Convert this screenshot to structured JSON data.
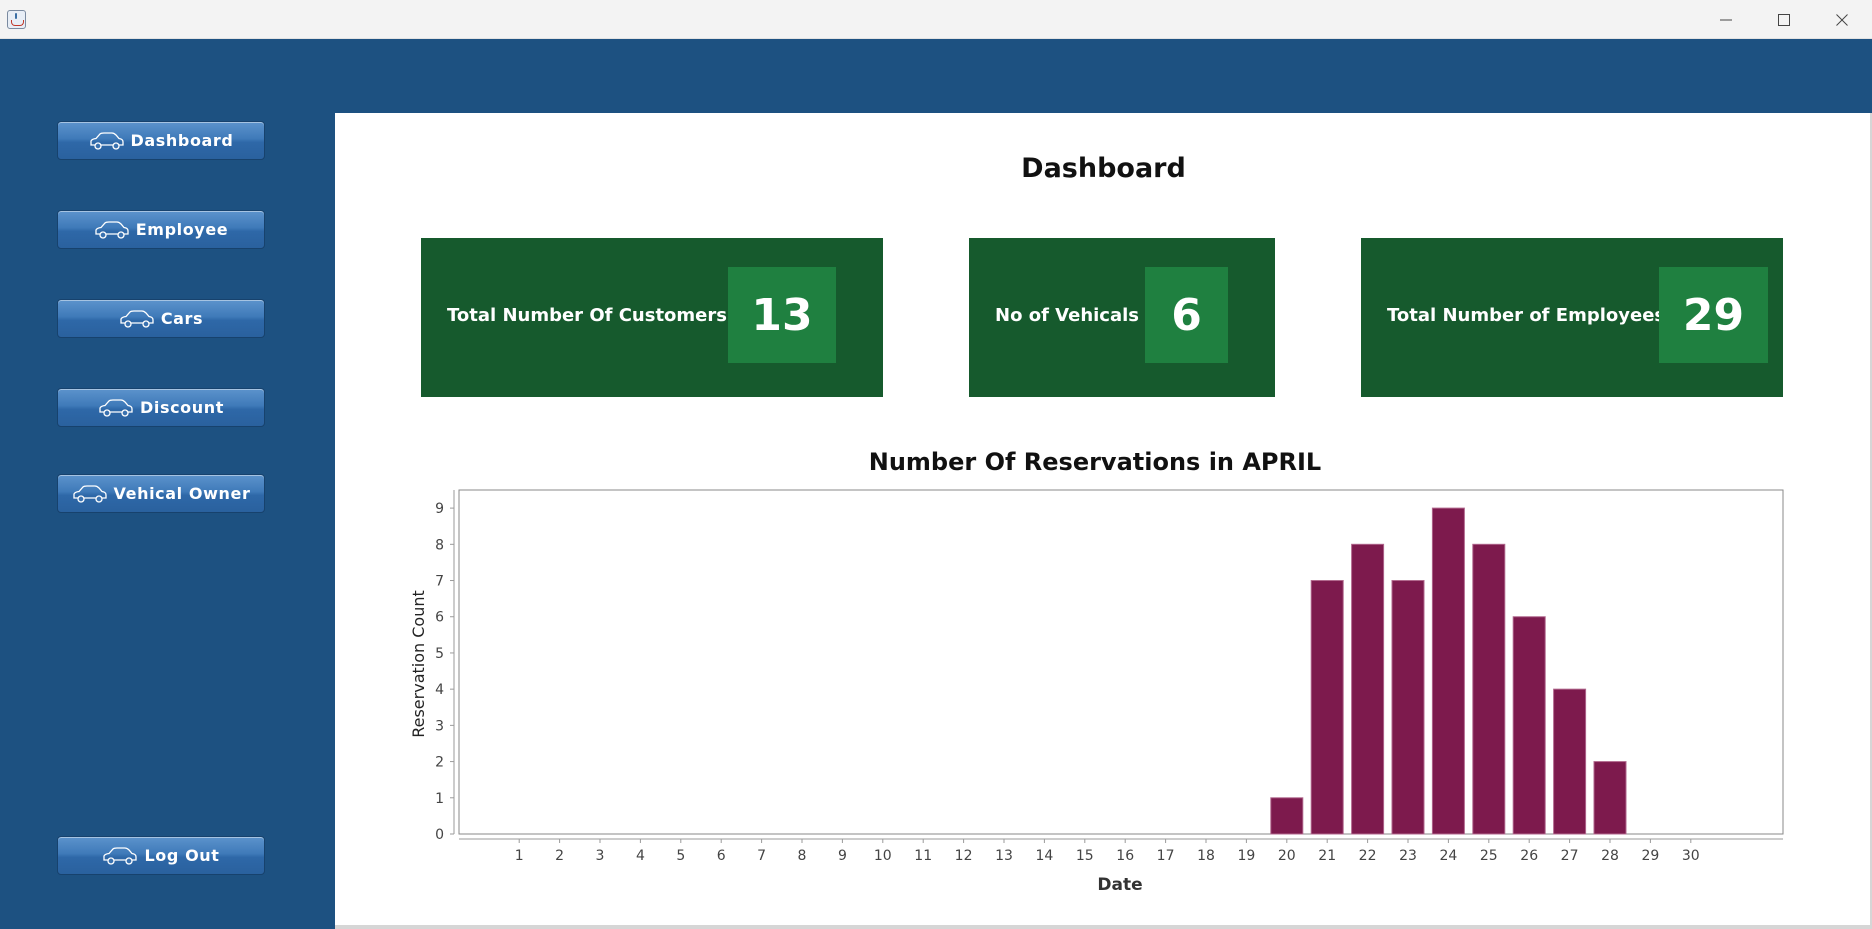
{
  "window": {
    "title_bar_buttons": [
      {
        "name": "minimize-icon",
        "glyph": "—"
      },
      {
        "name": "maximize-icon",
        "glyph": "□"
      },
      {
        "name": "close-icon",
        "glyph": "✕"
      }
    ]
  },
  "sidebar": {
    "items": [
      {
        "label": "Dashboard",
        "icon": "car-icon"
      },
      {
        "label": "Employee",
        "icon": "car-icon"
      },
      {
        "label": "Cars",
        "icon": "car-icon"
      },
      {
        "label": "Discount",
        "icon": "car-icon"
      },
      {
        "label": "Vehical Owner",
        "icon": "car-icon"
      }
    ],
    "logout": {
      "label": "Log Out",
      "icon": "car-icon"
    }
  },
  "main": {
    "title": "Dashboard",
    "stats": [
      {
        "label": "Total Number Of Customers",
        "value": "13"
      },
      {
        "label": "No of Vehicals",
        "value": "6"
      },
      {
        "label": "Total Number of Employees",
        "value": "29"
      }
    ]
  },
  "colors": {
    "sidebar": "#1d5181",
    "card": "#165a2d",
    "card_value_box": "#1f8040",
    "bar": "#7d1a4d"
  },
  "chart_data": {
    "type": "bar",
    "title": "Number Of Reservations in APRIL",
    "xlabel": "Date",
    "ylabel": "Reservation Count",
    "categories": [
      "1",
      "2",
      "3",
      "4",
      "5",
      "6",
      "7",
      "8",
      "9",
      "10",
      "11",
      "12",
      "13",
      "14",
      "15",
      "16",
      "17",
      "18",
      "19",
      "20",
      "21",
      "22",
      "23",
      "24",
      "25",
      "26",
      "27",
      "28",
      "29",
      "30"
    ],
    "values": [
      0,
      0,
      0,
      0,
      0,
      0,
      0,
      0,
      0,
      0,
      0,
      0,
      0,
      0,
      0,
      0,
      0,
      0,
      0,
      1,
      7,
      8,
      7,
      9,
      8,
      6,
      4,
      2,
      0,
      0
    ],
    "ylim": [
      0,
      9.5
    ],
    "yticks": [
      0,
      1,
      2,
      3,
      4,
      5,
      6,
      7,
      8,
      9
    ],
    "grid": false,
    "legend": "none"
  }
}
